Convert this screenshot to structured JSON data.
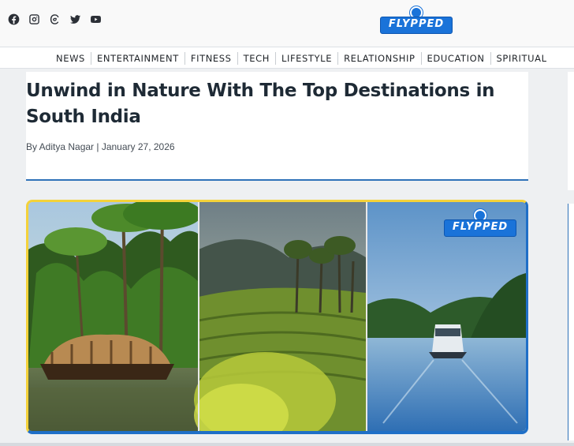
{
  "social": {
    "icons": [
      "facebook-icon",
      "instagram-icon",
      "threads-icon",
      "twitter-icon",
      "youtube-icon"
    ]
  },
  "logo": {
    "text": "FLYPPED",
    "brand_color": "#1a73d9"
  },
  "nav": {
    "items": [
      "NEWS",
      "ENTERTAINMENT",
      "FITNESS",
      "TECH",
      "LIFESTYLE",
      "RELATIONSHIP",
      "EDUCATION",
      "SPIRITUAL"
    ]
  },
  "article": {
    "title": "Unwind in Nature With The Top Destinations in South India",
    "byline": "By Aditya Nagar | January 27, 2026",
    "accent_color": "#2f72b8"
  },
  "hero": {
    "watermark_text": "FLYPPED",
    "border_top_color": "#f4d23a",
    "border_bottom_color": "#1f6fc7"
  }
}
